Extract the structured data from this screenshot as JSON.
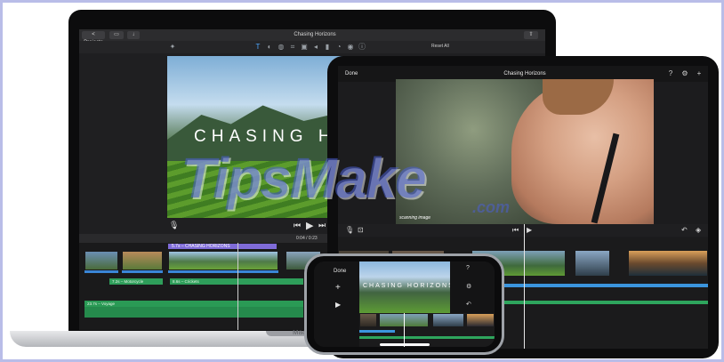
{
  "watermark": {
    "text": "TipsMake",
    "suffix": ".com"
  },
  "mac": {
    "brand": "Mac",
    "topbar": {
      "back_label": "< Projects",
      "title": "Chasing Horizons",
      "reset_label": "Reset All"
    },
    "viewer": {
      "title_overlay": "CHASING HO"
    },
    "timecode": "0:04 / 0:23",
    "timeline": {
      "title_clip": "5.7s – CHASING HORIZONS",
      "audio_clips": [
        {
          "label": "7.2s – Motorcycle"
        },
        {
          "label": "8.6s – Crickets"
        },
        {
          "label": "23.7s – Voyage"
        }
      ]
    }
  },
  "ipad": {
    "topbar": {
      "done_label": "Done",
      "title": "Chasing Horizons"
    },
    "viewer": {
      "caption": "scanning image"
    }
  },
  "iphone": {
    "left": {
      "done_label": "Done"
    },
    "viewer": {
      "title_overlay": "CHASING HORIZONS"
    }
  }
}
